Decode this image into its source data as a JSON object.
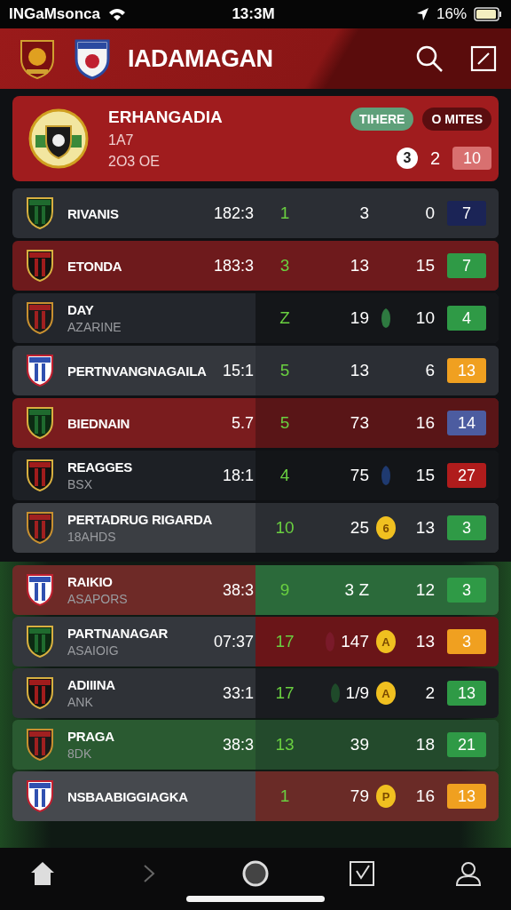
{
  "status_bar": {
    "carrier": "INGaMsonca",
    "time": "13:3M",
    "battery": "16%"
  },
  "header": {
    "title": "IADAMAGAN"
  },
  "featured": {
    "name": "ERHANGADIA",
    "line_1": "1A7",
    "line_2": "2O3 OE",
    "pills": [
      {
        "label": "TIHERE",
        "kind": "light"
      },
      {
        "label": "O MITES",
        "kind": "dark"
      }
    ],
    "circle": "3",
    "score": "2",
    "badge": "10"
  },
  "groups": [
    {
      "rows": [
        {
          "name": "RIVANIS",
          "time": "182:3",
          "c1": "1",
          "c2": "3",
          "c3": "0",
          "color": "#2b2e34",
          "stats": {
            "color": "#2b2e34"
          },
          "badge": {
            "text": "7",
            "color": "#1b2456"
          }
        },
        {
          "name": "ETONDA",
          "time": "183:3",
          "c1": "3",
          "c2": "13",
          "c3": "15",
          "color": "#6e1a1c",
          "stats": {
            "color": "#6e1a1c"
          },
          "badge": {
            "text": "7",
            "color": "#2f9a46"
          }
        },
        {
          "name": "DAY",
          "sub": "AZARINE",
          "c1": "Z",
          "c2": "19",
          "c3": "10",
          "color": "#23262c",
          "stats": {
            "color": "#141619"
          },
          "badge": {
            "text": "4",
            "color": "#2f9a46"
          },
          "marker": {
            "color": "#2e7a40"
          }
        },
        {
          "name": "PERTNVANGNAGAILA",
          "time": "15:1",
          "c1": "5",
          "c2": "13",
          "c3": "6",
          "color": "#34373d",
          "stats": {
            "color": "#2b2e34"
          },
          "badge": {
            "text": "13",
            "color": "#f0a020"
          }
        },
        {
          "name": "BIEDNAIN",
          "time": "5.7",
          "c1": "5",
          "c2": "73",
          "c3": "16",
          "color": "#7a1c1e",
          "stats": {
            "color": "#591517"
          },
          "badge": {
            "text": "14",
            "color": "#4c5ca0"
          }
        },
        {
          "name": "REAGGES",
          "sub": "BSX",
          "time": "18:1",
          "c1": "4",
          "c2": "75",
          "c3": "15",
          "color": "#1d2025",
          "stats": {
            "color": "#131518"
          },
          "badge": {
            "text": "27",
            "color": "#b01c1c"
          },
          "marker": {
            "color": "#1f3a70"
          }
        },
        {
          "name": "PERTADRUG RIGARDA",
          "sub": "18AHDS",
          "c1": "10",
          "c2": "25",
          "coin": "6",
          "c3": "13",
          "color": "#3b3e43",
          "stats": {
            "color": "#2b2e33"
          },
          "badge": {
            "text": "3",
            "color": "#2f9a46"
          }
        }
      ]
    },
    {
      "rows": [
        {
          "name": "RAIKIO",
          "sub": "ASAPORS",
          "time": "38:3",
          "c1": "9",
          "c2": "3 Z",
          "c3": "12",
          "color": "#6e2a27",
          "stats": {
            "color": "#2b6a3a"
          },
          "badge": {
            "text": "3",
            "color": "#2f9a46"
          }
        },
        {
          "name": "PARTNANAGAR",
          "sub": "ASAIOIG",
          "time": "07:37",
          "c1": "17",
          "c2": "147",
          "coin": "A",
          "c3": "13",
          "color": "#34373d",
          "stats": {
            "color": "#6a1518"
          },
          "badge": {
            "text": "3",
            "color": "#f0a020"
          },
          "marker": {
            "color": "#7a1a2a"
          }
        },
        {
          "name": "ADIIINA",
          "sub": "ANK",
          "time": "33:1",
          "c1": "17",
          "c2": "1/9",
          "coin": "A",
          "c3": "2",
          "color": "#2f3237",
          "stats": {
            "color": "#1a1c20"
          },
          "badge": {
            "text": "13",
            "color": "#2f9a46"
          },
          "marker": {
            "color": "#1f4a2a"
          }
        },
        {
          "name": "PRAGA",
          "sub": "8DK",
          "time": "38:3",
          "c1": "13",
          "c2": "39",
          "c3": "18",
          "color": "#2a5a31",
          "stats": {
            "color": "#234a2c"
          },
          "badge": {
            "text": "21",
            "color": "#2f9a46"
          }
        },
        {
          "name": "NSBAABIGGIAGKA",
          "c1": "1",
          "c2": "79",
          "coin": "P",
          "c3": "16",
          "color": "#46494e",
          "stats": {
            "color": "#6a2b27"
          },
          "badge": {
            "text": "13",
            "color": "#f0a020"
          }
        }
      ]
    }
  ]
}
